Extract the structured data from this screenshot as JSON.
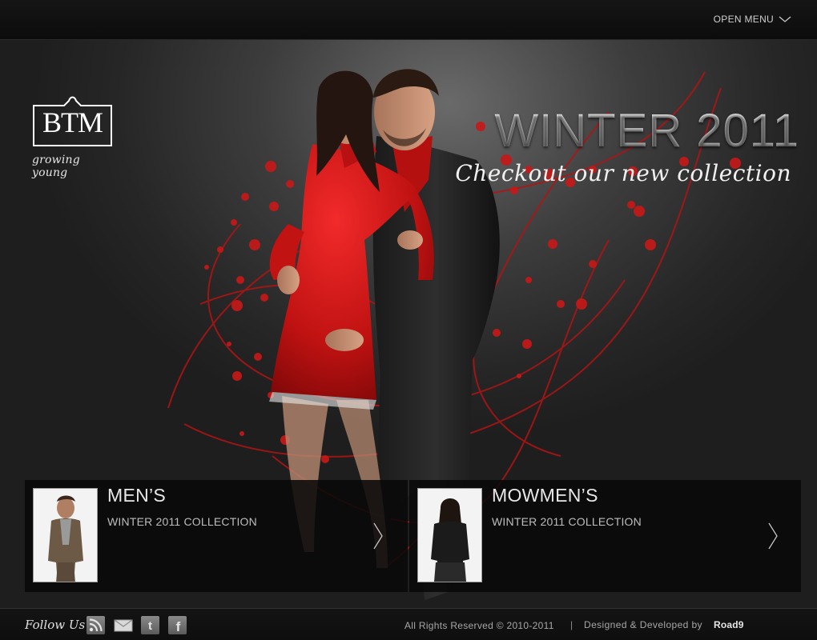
{
  "topbar": {
    "menu_label": "OPEN MENU"
  },
  "logo": {
    "text": "BTM",
    "tagline": "growing young"
  },
  "hero": {
    "title": "WINTER 2011",
    "subtitle": "Checkout our new collection"
  },
  "collections": [
    {
      "title": "MEN’S",
      "subtitle": "WINTER 2011 COLLECTION"
    },
    {
      "title": "MOWMEN’S",
      "subtitle": "WINTER 2011 COLLECTION"
    }
  ],
  "footer": {
    "follow_label": "Follow Us",
    "social_icons": [
      "rss-icon",
      "mail-icon",
      "twitter-icon",
      "facebook-icon"
    ],
    "copyright": "All Rights Reserved © 2010-2011",
    "separator": "|",
    "credit": "Designed & Developed by",
    "brand": "Road9"
  },
  "colors": {
    "accent_red": "#d01c1c",
    "background": "#262626",
    "panel": "#0a0a0a",
    "text_light": "#e8e8e8"
  }
}
